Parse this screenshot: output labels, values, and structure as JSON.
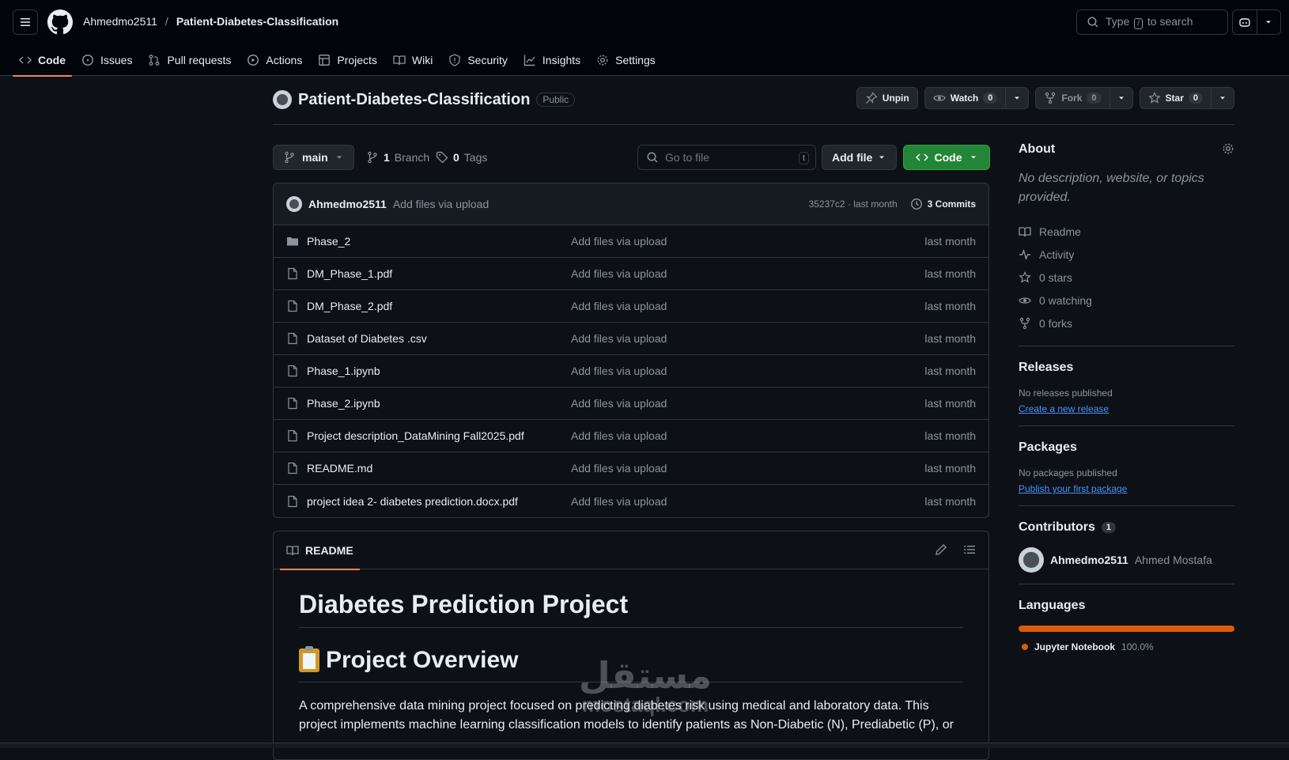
{
  "header": {
    "owner": "Ahmedmo2511",
    "separator": "/",
    "repo": "Patient-Diabetes-Classification",
    "search_prefix": "Type",
    "search_key": "/",
    "search_suffix": "to search"
  },
  "tabs": [
    {
      "label": "Code",
      "icon": "code-icon"
    },
    {
      "label": "Issues",
      "icon": "issue-icon"
    },
    {
      "label": "Pull requests",
      "icon": "pull-request-icon"
    },
    {
      "label": "Actions",
      "icon": "play-icon"
    },
    {
      "label": "Projects",
      "icon": "table-icon"
    },
    {
      "label": "Wiki",
      "icon": "book-icon"
    },
    {
      "label": "Security",
      "icon": "shield-icon"
    },
    {
      "label": "Insights",
      "icon": "graph-icon"
    },
    {
      "label": "Settings",
      "icon": "gear-icon"
    }
  ],
  "repo_header": {
    "name": "Patient-Diabetes-Classification",
    "visibility": "Public",
    "unpin": "Unpin",
    "watch": "Watch",
    "watch_count": "0",
    "fork": "Fork",
    "fork_count": "0",
    "star": "Star",
    "star_count": "0"
  },
  "branchbar": {
    "branch": "main",
    "branch_count": "1",
    "branch_label": "Branch",
    "tag_count": "0",
    "tag_label": "Tags",
    "goto_placeholder": "Go to file",
    "goto_key": "t",
    "add_file": "Add file",
    "code": "Code"
  },
  "latest_commit": {
    "user": "Ahmedmo2511",
    "message": "Add files via upload",
    "sha_time": "35237c2 · last month",
    "commits": "3 Commits"
  },
  "files": [
    {
      "name": "Phase_2",
      "type": "folder",
      "commit": "Add files via upload",
      "time": "last month"
    },
    {
      "name": "DM_Phase_1.pdf",
      "type": "file",
      "commit": "Add files via upload",
      "time": "last month"
    },
    {
      "name": "DM_Phase_2.pdf",
      "type": "file",
      "commit": "Add files via upload",
      "time": "last month"
    },
    {
      "name": "Dataset of Diabetes .csv",
      "type": "file",
      "commit": "Add files via upload",
      "time": "last month"
    },
    {
      "name": "Phase_1.ipynb",
      "type": "file",
      "commit": "Add files via upload",
      "time": "last month"
    },
    {
      "name": "Phase_2.ipynb",
      "type": "file",
      "commit": "Add files via upload",
      "time": "last month"
    },
    {
      "name": "Project description_DataMining Fall2025.pdf",
      "type": "file",
      "commit": "Add files via upload",
      "time": "last month"
    },
    {
      "name": "README.md",
      "type": "file",
      "commit": "Add files via upload",
      "time": "last month"
    },
    {
      "name": "project idea 2- diabetes prediction.docx.pdf",
      "type": "file",
      "commit": "Add files via upload",
      "time": "last month"
    }
  ],
  "readme": {
    "tab": "README",
    "h1": "Diabetes Prediction Project",
    "h2": "Project Overview",
    "para": "A comprehensive data mining project focused on predicting diabetes risk using medical and laboratory data. This project implements machine learning classification models to identify patients as Non-Diabetic (N), Prediabetic (P), or"
  },
  "watermark": {
    "line1": "مستقل",
    "line2": "mostaql.com"
  },
  "about": {
    "title": "About",
    "description": "No description, website, or topics provided.",
    "stats": [
      {
        "icon": "book-icon",
        "label": "Readme"
      },
      {
        "icon": "pulse-icon",
        "label": "Activity"
      },
      {
        "icon": "star-icon",
        "label": "0 stars"
      },
      {
        "icon": "eye-icon",
        "label": "0 watching"
      },
      {
        "icon": "fork-icon",
        "label": "0 forks"
      }
    ]
  },
  "releases": {
    "title": "Releases",
    "text": "No releases published",
    "link": "Create a new release"
  },
  "packages": {
    "title": "Packages",
    "text": "No packages published",
    "link": "Publish your first package"
  },
  "contributors": {
    "title": "Contributors",
    "count": "1",
    "login": "Ahmedmo2511",
    "name": "Ahmed Mostafa"
  },
  "languages": {
    "title": "Languages",
    "name": "Jupyter Notebook",
    "percent_label": "100.0%",
    "percent": 100,
    "color": "#da5b0b"
  }
}
